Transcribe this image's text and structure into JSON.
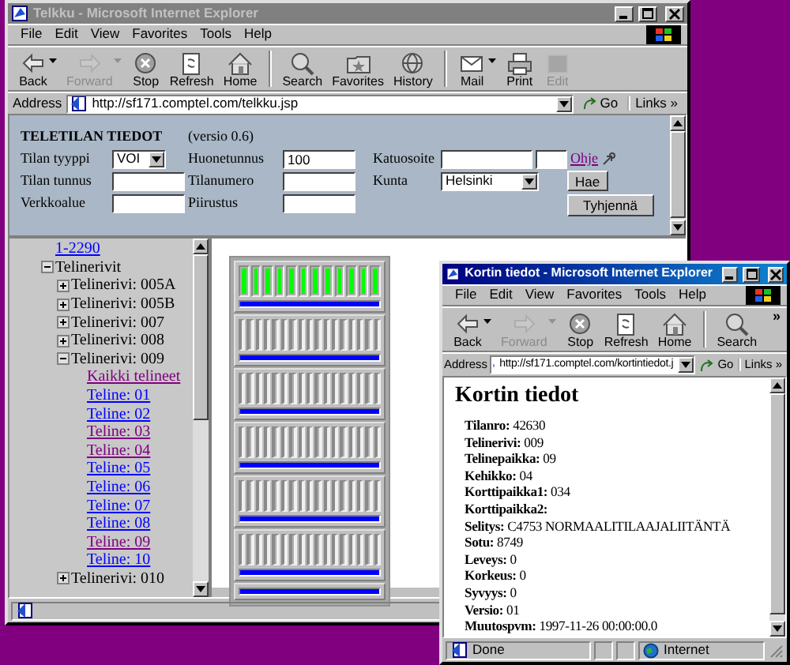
{
  "main_window": {
    "title": "Telkku - Microsoft Internet Explorer",
    "active": false,
    "menu": [
      "File",
      "Edit",
      "View",
      "Favorites",
      "Tools",
      "Help"
    ],
    "toolbar": [
      [
        {
          "label": "Back",
          "disabled": false,
          "dropdown": true
        },
        {
          "label": "Forward",
          "disabled": true,
          "dropdown": true
        },
        {
          "label": "Stop",
          "disabled": false
        },
        {
          "label": "Refresh",
          "disabled": false
        },
        {
          "label": "Home",
          "disabled": false
        }
      ],
      [
        {
          "label": "Search",
          "disabled": false
        },
        {
          "label": "Favorites",
          "disabled": false
        },
        {
          "label": "History",
          "disabled": false
        }
      ],
      [
        {
          "label": "Mail",
          "disabled": false,
          "dropdown": true
        },
        {
          "label": "Print",
          "disabled": false
        },
        {
          "label": "Edit",
          "disabled": true
        }
      ]
    ],
    "address": {
      "label": "Address",
      "url": "http://sf171.comptel.com/telkku.jsp",
      "go": "Go",
      "links": "Links",
      "links_more": "»"
    },
    "form": {
      "heading": "TELETILAN TIEDOT",
      "version": "(versio 0.6)",
      "rows": [
        [
          {
            "kind": "select",
            "label": "Tilan tyyppi",
            "value": "VOI"
          },
          {
            "kind": "text",
            "label": "Huonetunnus",
            "value": "100"
          },
          {
            "kind": "address",
            "label": "Katuosoite",
            "link": {
              "label": "Ohje",
              "visited": true
            }
          }
        ],
        [
          {
            "kind": "text",
            "label": "Tilan tunnus"
          },
          {
            "kind": "text",
            "label": "Tilanumero"
          },
          {
            "kind": "select",
            "label": "Kunta",
            "value": "Helsinki"
          },
          {
            "kind": "button",
            "label": "Hae"
          }
        ],
        [
          {
            "kind": "text",
            "label": "Verkkoalue"
          },
          {
            "kind": "text",
            "label": "Piirustus"
          },
          {
            "kind": "button",
            "label": "Tyhjennä"
          }
        ]
      ]
    },
    "tree": [
      {
        "kind": "link",
        "label": "1-2290",
        "visited": false
      },
      {
        "kind": "node",
        "label": "Telinerivit",
        "expanded": true,
        "children": [
          {
            "kind": "node",
            "label": "Telinerivi: 005A",
            "expanded": false
          },
          {
            "kind": "node",
            "label": "Telinerivi: 005B",
            "expanded": false
          },
          {
            "kind": "node",
            "label": "Telinerivi: 007",
            "expanded": false
          },
          {
            "kind": "node",
            "label": "Telinerivi: 008",
            "expanded": false
          },
          {
            "kind": "node",
            "label": "Telinerivi: 009",
            "expanded": true,
            "children": [
              {
                "kind": "link",
                "label": "Kaikki telineet",
                "visited": true
              },
              {
                "kind": "link",
                "label": "Teline: 01",
                "visited": false
              },
              {
                "kind": "link",
                "label": "Teline: 02",
                "visited": false
              },
              {
                "kind": "link",
                "label": "Teline: 03",
                "visited": true
              },
              {
                "kind": "link",
                "label": "Teline: 04",
                "visited": true
              },
              {
                "kind": "link",
                "label": "Teline: 05",
                "visited": false
              },
              {
                "kind": "link",
                "label": "Teline: 06",
                "visited": false
              },
              {
                "kind": "link",
                "label": "Teline: 07",
                "visited": false
              },
              {
                "kind": "link",
                "label": "Teline: 08",
                "visited": false
              },
              {
                "kind": "link",
                "label": "Teline: 09",
                "visited": true
              },
              {
                "kind": "link",
                "label": "Teline: 10",
                "visited": false
              }
            ]
          },
          {
            "kind": "node",
            "label": "Telinerivi: 010",
            "expanded": false
          }
        ]
      }
    ],
    "rack": {
      "modules": [
        {
          "kind": "wide"
        },
        {
          "kind": "narrow"
        },
        {
          "kind": "narrow"
        },
        {
          "kind": "narrow"
        },
        {
          "kind": "narrow"
        },
        {
          "kind": "narrow"
        },
        {
          "kind": "blank"
        }
      ]
    }
  },
  "popup_window": {
    "title": "Kortin tiedot - Microsoft Internet Explorer",
    "active": true,
    "menu": [
      "File",
      "Edit",
      "View",
      "Favorites",
      "Tools",
      "Help"
    ],
    "toolbar": [
      [
        {
          "label": "Back",
          "disabled": false,
          "dropdown": true
        },
        {
          "label": "Forward",
          "disabled": true,
          "dropdown": true
        },
        {
          "label": "Stop",
          "disabled": false
        },
        {
          "label": "Refresh",
          "disabled": false
        },
        {
          "label": "Home",
          "disabled": false
        }
      ],
      [
        {
          "label": "Search",
          "disabled": false
        }
      ]
    ],
    "toolbar_more": "»",
    "address": {
      "label": "Address",
      "url": "http://sf171.comptel.com/kortintiedot.j",
      "go": "Go",
      "links": "Links",
      "links_more": "»"
    },
    "heading": "Kortin tiedot",
    "fields": [
      "**Tilanro:** 42630",
      "**Telinerivi:** 009",
      "**Telinepaikka:** 09",
      "**Kehikko:** 04",
      "**Korttipaikka1:** 034",
      "**Korttipaikka2:**",
      "**Selitys:** C4753 NORMAALITILAAJALIITÄNTÄ",
      "**Sotu:** 8749",
      "**Leveys:** 0",
      "**Korkeus:** 0",
      "**Syvyys:** 0",
      "**Versio:** 01",
      "**Muutospvm:** 1997-11-26 00:00:00.0"
    ],
    "status": {
      "text": "Done",
      "zone": "Internet"
    }
  }
}
